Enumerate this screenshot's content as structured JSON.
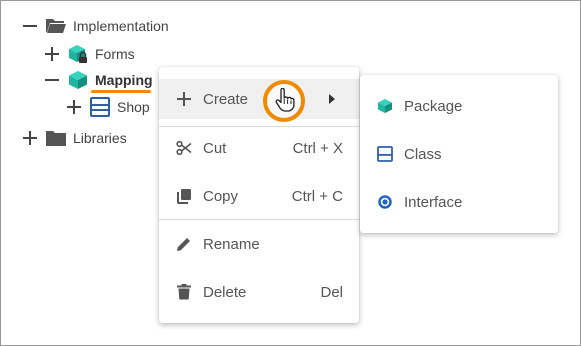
{
  "tree": {
    "items": [
      {
        "label": "Implementation",
        "toggle": "collapse",
        "icon": "folder-open-icon"
      },
      {
        "label": "Forms",
        "toggle": "expand",
        "icon": "package-locked-icon"
      },
      {
        "label": "Mapping",
        "toggle": "collapse",
        "icon": "package-icon",
        "selected": true
      },
      {
        "label": "Shop",
        "toggle": "expand",
        "icon": "class-icon"
      },
      {
        "label": "Libraries",
        "toggle": "expand",
        "icon": "folder-icon"
      }
    ]
  },
  "context_menu": {
    "items": [
      {
        "label": "Create",
        "icon": "plus-icon",
        "shortcut": "",
        "submenu": true
      },
      {
        "label": "Cut",
        "icon": "scissors-icon",
        "shortcut": "Ctrl + X"
      },
      {
        "label": "Copy",
        "icon": "copy-icon",
        "shortcut": "Ctrl + C"
      },
      {
        "label": "Rename",
        "icon": "pencil-icon",
        "shortcut": ""
      },
      {
        "label": "Delete",
        "icon": "trash-icon",
        "shortcut": "Del"
      }
    ]
  },
  "create_submenu": {
    "items": [
      {
        "label": "Package",
        "icon": "package-icon"
      },
      {
        "label": "Class",
        "icon": "class-icon"
      },
      {
        "label": "Interface",
        "icon": "interface-icon"
      }
    ]
  },
  "colors": {
    "accent": "#f08a00",
    "package_teal": "#1fb5a1",
    "class_blue": "#2f5fa8",
    "interface_blue": "#1e63c9",
    "folder_gray": "#555555"
  }
}
